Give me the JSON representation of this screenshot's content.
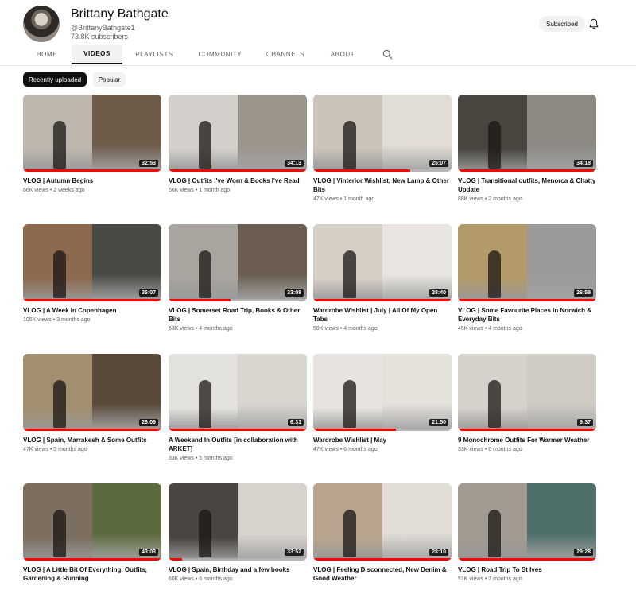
{
  "channel": {
    "name": "Brittany Bathgate",
    "handle": "@BrittanyBathgate1",
    "subscribers": "73.8K subscribers",
    "subscribe_label": "Subscribed"
  },
  "tabs": [
    {
      "label": "HOME",
      "active": false
    },
    {
      "label": "VIDEOS",
      "active": true
    },
    {
      "label": "PLAYLISTS",
      "active": false
    },
    {
      "label": "COMMUNITY",
      "active": false
    },
    {
      "label": "CHANNELS",
      "active": false
    },
    {
      "label": "ABOUT",
      "active": false
    }
  ],
  "chips": [
    {
      "label": "Recently uploaded",
      "active": true
    },
    {
      "label": "Popular",
      "active": false
    }
  ],
  "icons": {
    "bell": "bell-icon",
    "search": "search-icon"
  },
  "colors": {
    "progress": "#ff0000",
    "chip_active": "#0f0f0f",
    "text_secondary": "#606060"
  },
  "videos": [
    {
      "title": "VLOG | Autumn Begins",
      "meta": "66K views • 2 weeks ago",
      "duration": "32:53",
      "progress": 1.0,
      "colors": [
        "#bdb6ad",
        "#6e5b4a"
      ]
    },
    {
      "title": "VLOG | Outfits I've Worn & Books I've Read",
      "meta": "66K views • 1 month ago",
      "duration": "34:13",
      "progress": 1.0,
      "colors": [
        "#d3d0cb",
        "#9c958c"
      ]
    },
    {
      "title": "VLOG | Vinterior Wishlist, New Lamp & Other Bits",
      "meta": "47K views • 1 month ago",
      "duration": "25:07",
      "progress": 0.7,
      "colors": [
        "#c9c3b9",
        "#e2ddd4"
      ]
    },
    {
      "title": "VLOG | Transitional outfits, Menorca & Chatty Update",
      "meta": "88K views • 2 months ago",
      "duration": "34:18",
      "progress": 1.0,
      "colors": [
        "#48463f",
        "#8c8983"
      ]
    },
    {
      "title": "VLOG | A Week In Copenhagen",
      "meta": "105K views • 3 months ago",
      "duration": "35:07",
      "progress": 1.0,
      "colors": [
        "#8d6a4d",
        "#4a4a45"
      ]
    },
    {
      "title": "VLOG | Somerset Road Trip, Books & Other Bits",
      "meta": "63K views • 4 months ago",
      "duration": "33:08",
      "progress": 0.45,
      "colors": [
        "#a8a49e",
        "#6b5e50"
      ]
    },
    {
      "title": "Wardrobe Wishlist | July | All Of My Open Tabs",
      "meta": "50K views • 4 months ago",
      "duration": "28:40",
      "progress": 1.0,
      "colors": [
        "#d6cfc6",
        "#e9e6e1"
      ]
    },
    {
      "title": "VLOG | Some Favourite Places In Norwich & Everyday Bits",
      "meta": "45K views • 4 months ago",
      "duration": "26:59",
      "progress": 1.0,
      "colors": [
        "#b39a6a",
        "#9b9a98"
      ]
    },
    {
      "title": "VLOG | Spain, Marrakesh & Some Outfits",
      "meta": "47K views • 5 months ago",
      "duration": "26:09",
      "progress": 1.0,
      "colors": [
        "#a38f6f",
        "#5a4a3b"
      ]
    },
    {
      "title": "A Weekend In Outfits [in collaboration with ARKET]",
      "meta": "33K views • 5 months ago",
      "duration": "6:31",
      "progress": 1.0,
      "colors": [
        "#e3e1dd",
        "#d9d6d0"
      ]
    },
    {
      "title": "Wardrobe Wishlist | May",
      "meta": "47K views • 6 months ago",
      "duration": "21:50",
      "progress": 0.6,
      "colors": [
        "#e7e4df",
        "#e5e1db"
      ]
    },
    {
      "title": "9 Monochrome Outfits For Warmer Weather",
      "meta": "33K views • 6 months ago",
      "duration": "9:37",
      "progress": 1.0,
      "colors": [
        "#d5d1cb",
        "#cfcbc4"
      ]
    },
    {
      "title": "VLOG | A Little Bit Of Everything. Outfits, Gardening & Running",
      "meta": "",
      "duration": "43:03",
      "progress": 1.0,
      "colors": [
        "#7c6f60",
        "#5c6b3d"
      ]
    },
    {
      "title": "VLOG | Spain, Birthday and a few books",
      "meta": "60K views • 6 months ago",
      "duration": "33:52",
      "progress": 0.1,
      "colors": [
        "#4a4540",
        "#d8d4cd"
      ]
    },
    {
      "title": "VLOG | Feeling Disconnected, New Denim & Good Weather",
      "meta": "",
      "duration": "28:10",
      "progress": 1.0,
      "colors": [
        "#b9a58f",
        "#e2ddd6"
      ]
    },
    {
      "title": "VLOG | Road Trip To St Ives",
      "meta": "51K views • 7 months ago",
      "duration": "29:28",
      "progress": 1.0,
      "colors": [
        "#a19a90",
        "#4f6f6a"
      ]
    }
  ]
}
